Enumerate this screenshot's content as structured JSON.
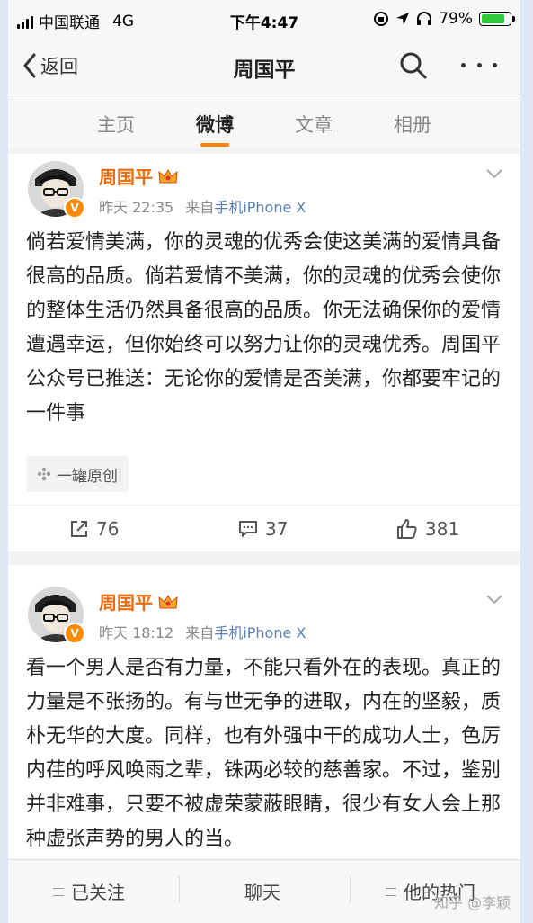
{
  "status": {
    "carrier": "中国联通",
    "network": "4G",
    "time": "下午4:47",
    "battery": "79%"
  },
  "nav": {
    "back_label": "返回",
    "title": "周国平"
  },
  "tabs": [
    "主页",
    "微博",
    "文章",
    "相册"
  ],
  "posts": [
    {
      "username": "周国平",
      "time": "昨天 22:35",
      "source_prefix": "来自",
      "source": "手机iPhone X",
      "text": "倘若爱情美满，你的灵魂的优秀会使这美满的爱情具备很高的品质。倘若爱情不美满，你的灵魂的优秀会使你的整体生活仍然具备很高的品质。你无法确保你的爱情遭遇幸运，但你始终可以努力让你的灵魂优秀。周国平公众号已推送：无论你的爱情是否美满，你都要牢记的一件事",
      "tag": "一罐原创",
      "reposts": "76",
      "comments": "37",
      "likes": "381"
    },
    {
      "username": "周国平",
      "time": "昨天 18:12",
      "source_prefix": "来自",
      "source": "手机iPhone X",
      "text": "看一个男人是否有力量，不能只看外在的表现。真正的力量是不张扬的。有与世无争的进取，内在的坚毅，质朴无华的大度。同样，也有外强中干的成功人士，色厉内荏的呼风唤雨之辈，铢两必较的慈善家。不过，鉴别并非难事，只要不被虚荣蒙蔽眼睛，很少有女人会上那种虚张声势的男人的当。"
    }
  ],
  "bottom": {
    "follow": "已关注",
    "chat": "聊天",
    "hot": "他的热门"
  },
  "watermark": "知乎 @李颖",
  "colors": {
    "accent": "#ff8200",
    "username": "#e86b0c",
    "source": "#5b7fb3"
  }
}
